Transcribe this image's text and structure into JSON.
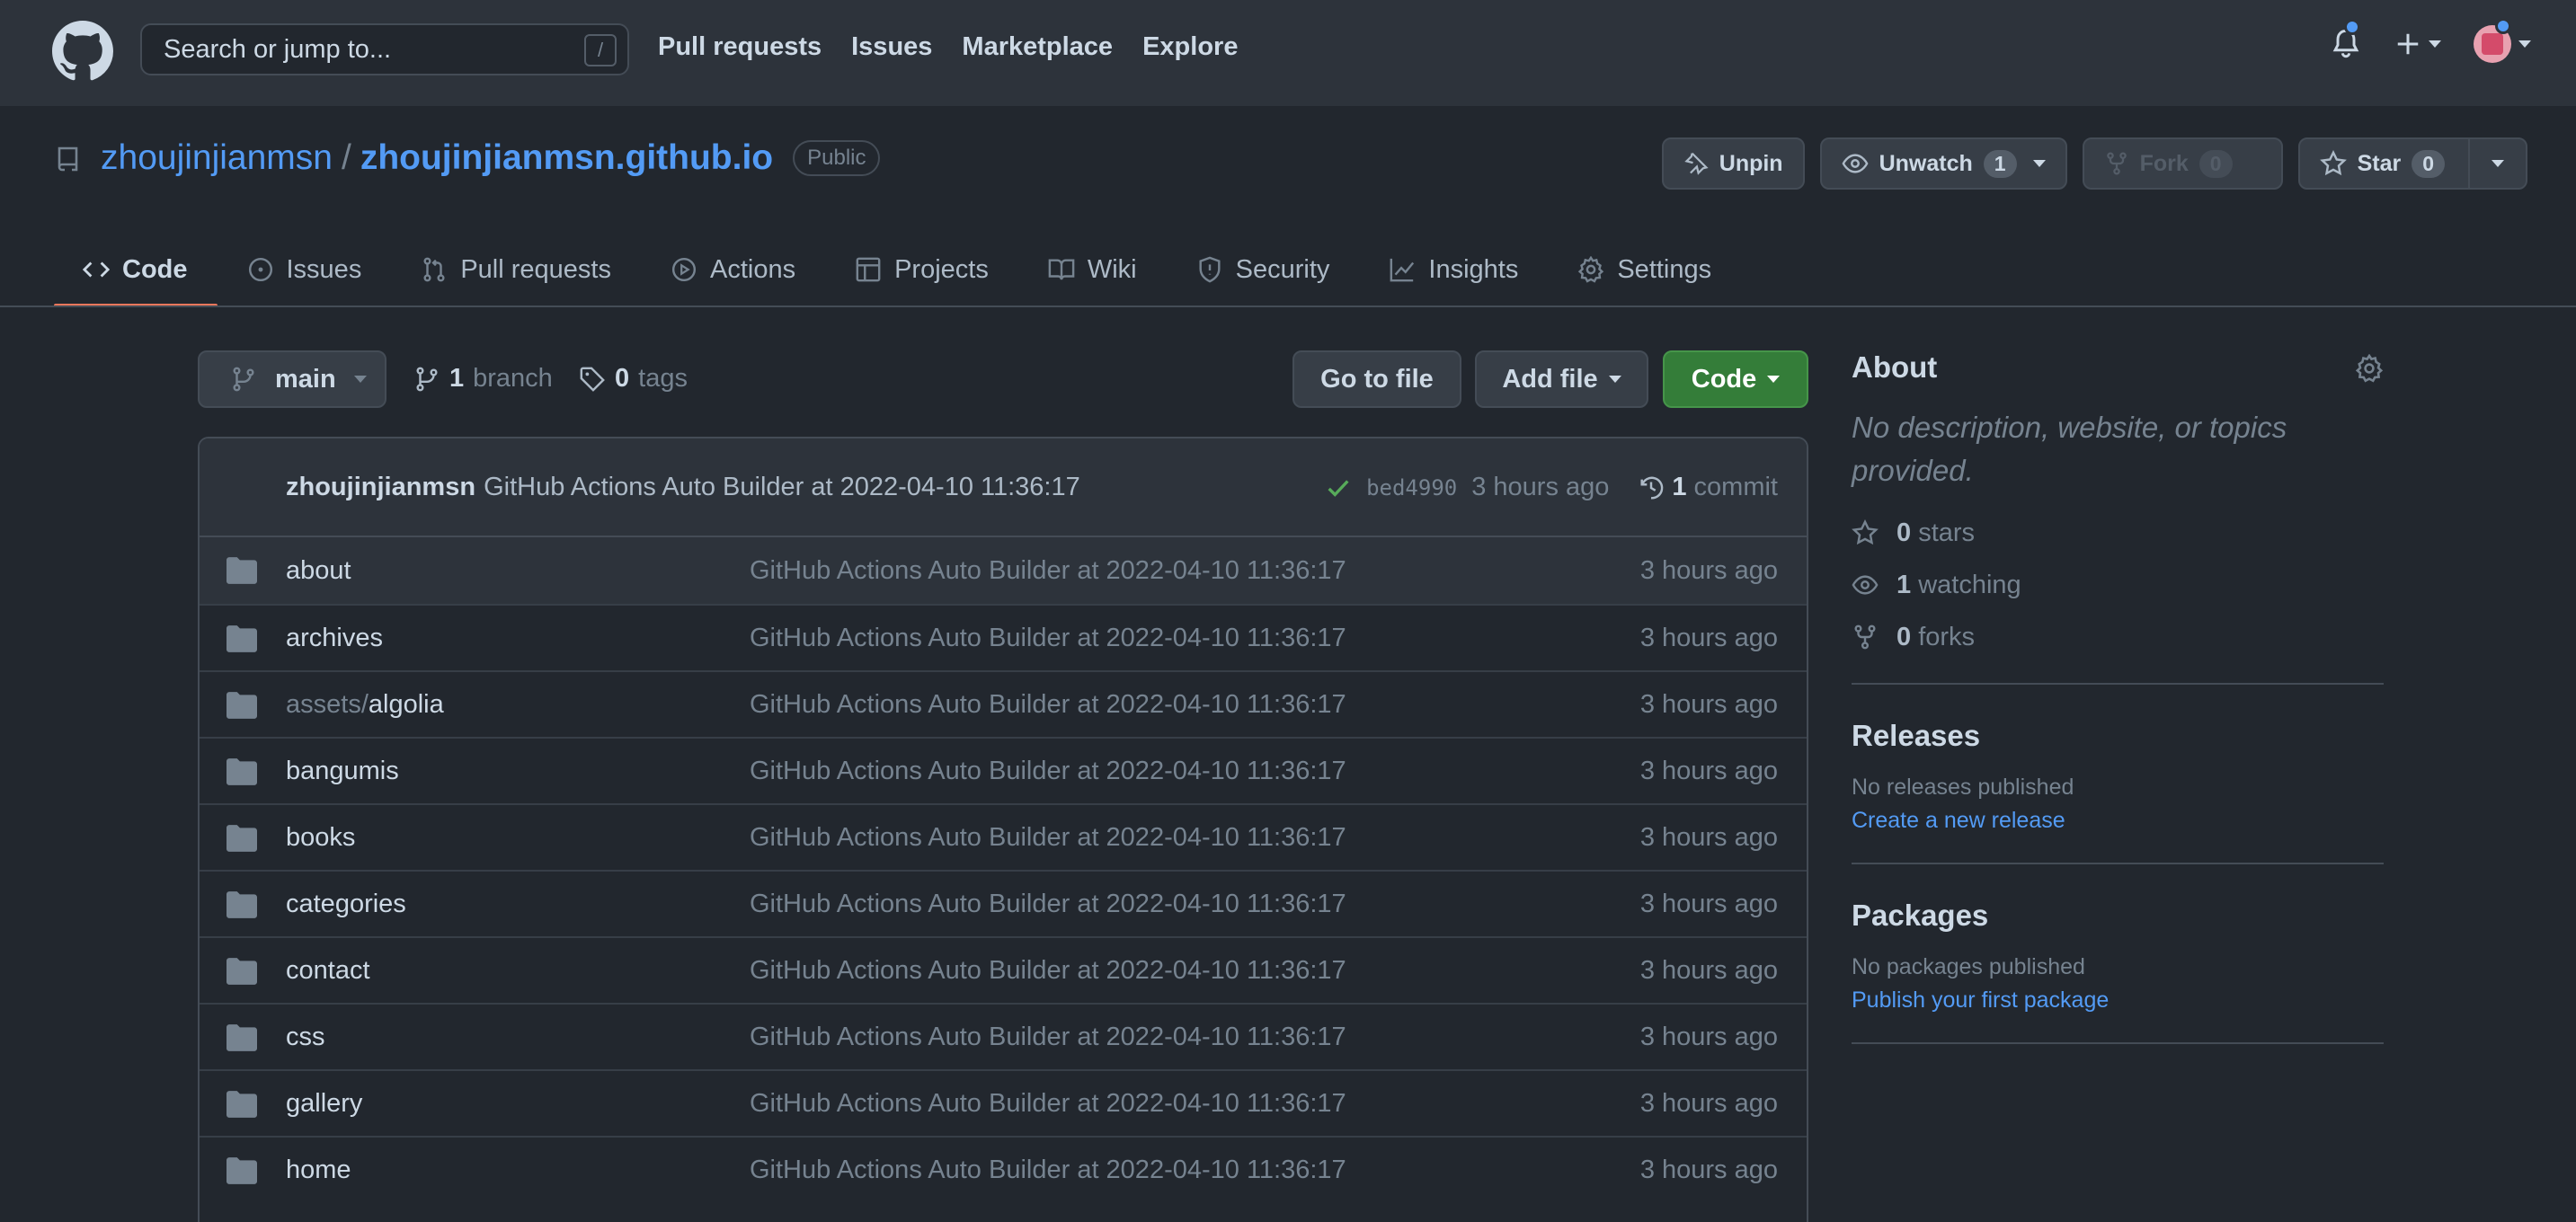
{
  "header": {
    "search_placeholder": "Search or jump to...",
    "search_shortcut": "/",
    "nav": [
      "Pull requests",
      "Issues",
      "Marketplace",
      "Explore"
    ]
  },
  "repo": {
    "owner": "zhoujinjianmsn",
    "separator": "/",
    "name": "zhoujinjianmsn.github.io",
    "visibility": "Public",
    "unpin_label": "Unpin",
    "unwatch_label": "Unwatch",
    "watch_count": "1",
    "fork_label": "Fork",
    "fork_count": "0",
    "star_label": "Star",
    "star_count": "0"
  },
  "tabs": [
    {
      "label": "Code",
      "icon": "code-icon"
    },
    {
      "label": "Issues",
      "icon": "issue-icon"
    },
    {
      "label": "Pull requests",
      "icon": "pull-request-icon"
    },
    {
      "label": "Actions",
      "icon": "play-icon"
    },
    {
      "label": "Projects",
      "icon": "table-icon"
    },
    {
      "label": "Wiki",
      "icon": "book-icon"
    },
    {
      "label": "Security",
      "icon": "shield-icon"
    },
    {
      "label": "Insights",
      "icon": "graph-icon"
    },
    {
      "label": "Settings",
      "icon": "gear-icon"
    }
  ],
  "toolbar": {
    "branch": "main",
    "branch_count": "1",
    "branch_label": "branch",
    "tag_count": "0",
    "tag_label": "tags",
    "goto_file": "Go to file",
    "add_file": "Add file",
    "code": "Code"
  },
  "latest_commit": {
    "author": "zhoujinjianmsn",
    "message": "GitHub Actions Auto Builder at 2022-04-10 11:36:17",
    "sha": "bed4990",
    "age": "3 hours ago",
    "commit_count": "1",
    "commit_label": "commit"
  },
  "files": [
    {
      "prefix": "",
      "name": "about",
      "message": "GitHub Actions Auto Builder at 2022-04-10 11:36:17",
      "age": "3 hours ago"
    },
    {
      "prefix": "",
      "name": "archives",
      "message": "GitHub Actions Auto Builder at 2022-04-10 11:36:17",
      "age": "3 hours ago"
    },
    {
      "prefix": "assets/",
      "name": "algolia",
      "message": "GitHub Actions Auto Builder at 2022-04-10 11:36:17",
      "age": "3 hours ago"
    },
    {
      "prefix": "",
      "name": "bangumis",
      "message": "GitHub Actions Auto Builder at 2022-04-10 11:36:17",
      "age": "3 hours ago"
    },
    {
      "prefix": "",
      "name": "books",
      "message": "GitHub Actions Auto Builder at 2022-04-10 11:36:17",
      "age": "3 hours ago"
    },
    {
      "prefix": "",
      "name": "categories",
      "message": "GitHub Actions Auto Builder at 2022-04-10 11:36:17",
      "age": "3 hours ago"
    },
    {
      "prefix": "",
      "name": "contact",
      "message": "GitHub Actions Auto Builder at 2022-04-10 11:36:17",
      "age": "3 hours ago"
    },
    {
      "prefix": "",
      "name": "css",
      "message": "GitHub Actions Auto Builder at 2022-04-10 11:36:17",
      "age": "3 hours ago"
    },
    {
      "prefix": "",
      "name": "gallery",
      "message": "GitHub Actions Auto Builder at 2022-04-10 11:36:17",
      "age": "3 hours ago"
    },
    {
      "prefix": "",
      "name": "home",
      "message": "GitHub Actions Auto Builder at 2022-04-10 11:36:17",
      "age": "3 hours ago"
    }
  ],
  "sidebar": {
    "about_title": "About",
    "about_desc": "No description, website, or topics provided.",
    "stars_count": "0",
    "stars_label": "stars",
    "watching_count": "1",
    "watching_label": "watching",
    "forks_count": "0",
    "forks_label": "forks",
    "releases_title": "Releases",
    "releases_note": "No releases published",
    "releases_link": "Create a new release",
    "packages_title": "Packages",
    "packages_note": "No packages published",
    "packages_link": "Publish your first package"
  },
  "colors": {
    "background": "#22272e",
    "header": "#2d333b",
    "accent_link": "#539bf5",
    "code_button": "#347d39",
    "active_tab_underline": "#ec775c",
    "commit_check": "#57ab5a"
  }
}
